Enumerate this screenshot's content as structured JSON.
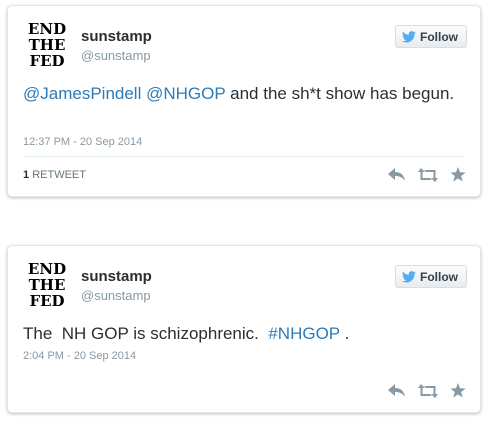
{
  "tweets": [
    {
      "name": "sunstamp",
      "handle": "@sunstamp",
      "follow_label": "Follow",
      "avatar_words": [
        "END",
        "THE",
        "FED"
      ],
      "text_parts": [
        {
          "text": "@JamesPindell",
          "kind": "mention"
        },
        {
          "text": " ",
          "kind": "plain"
        },
        {
          "text": "@NHGOP",
          "kind": "mention"
        },
        {
          "text": " and the sh*t show has begun.",
          "kind": "plain"
        }
      ],
      "timestamp": "12:37 PM - 20 Sep 2014",
      "retweet_count": "1",
      "retweet_label": "RETWEET"
    },
    {
      "name": "sunstamp",
      "handle": "@sunstamp",
      "follow_label": "Follow",
      "avatar_words": [
        "END",
        "THE",
        "FED"
      ],
      "text_parts": [
        {
          "text": "The  NH GOP is schizophrenic.  ",
          "kind": "plain"
        },
        {
          "text": "#NHGOP",
          "kind": "hashtag"
        },
        {
          "text": " .",
          "kind": "plain"
        }
      ],
      "timestamp": "2:04 PM - 20 Sep 2014"
    }
  ],
  "colors": {
    "link": "#2b7bb9",
    "text": "#292f33",
    "muted": "#8899a6",
    "icon": "#8899a6",
    "twitter_bird": "#55acee"
  },
  "icons": {
    "follow": "twitter-bird-icon",
    "reply": "reply-icon",
    "retweet": "retweet-icon",
    "favorite": "star-icon"
  }
}
